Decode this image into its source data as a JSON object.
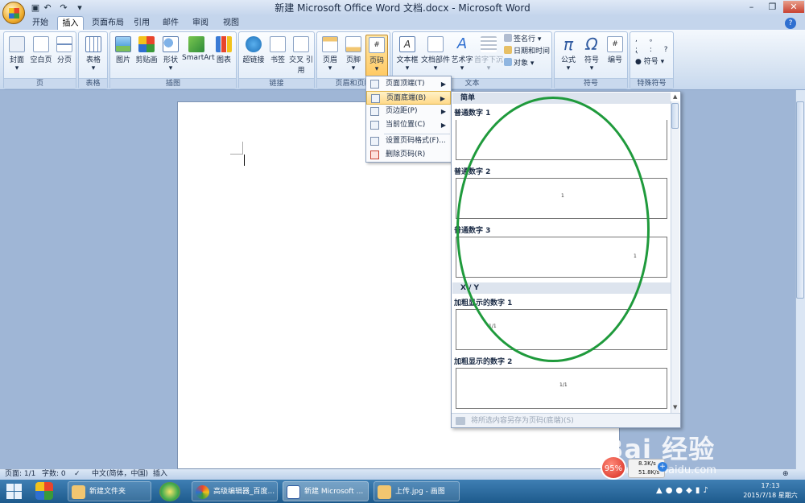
{
  "window": {
    "title": "新建 Microsoft Office Word 文档.docx - Microsoft Word"
  },
  "quick_access": {
    "save": "💾",
    "undo": "↶",
    "redo": "↷",
    "customize": "▾"
  },
  "tabs": [
    "开始",
    "插入",
    "页面布局",
    "引用",
    "邮件",
    "审阅",
    "视图"
  ],
  "active_tab": "插入",
  "ribbon": {
    "groups": [
      {
        "label": "页",
        "buttons": [
          "封面",
          "空白页",
          "分页"
        ]
      },
      {
        "label": "表格",
        "buttons": [
          "表格"
        ]
      },
      {
        "label": "插图",
        "buttons": [
          "图片",
          "剪贴画",
          "形状",
          "SmartArt",
          "图表"
        ]
      },
      {
        "label": "链接",
        "buttons": [
          "超链接",
          "书签",
          "交叉\n引用"
        ]
      },
      {
        "label": "页眉和页脚",
        "buttons": [
          "页眉",
          "页脚",
          "页码"
        ]
      },
      {
        "label": "文本",
        "buttons": [
          "文本框",
          "文档部件",
          "艺术字",
          "首字下沉"
        ],
        "small": [
          "签名行",
          "日期和时间",
          "对象"
        ]
      },
      {
        "label": "符号",
        "buttons": [
          "公式",
          "符号",
          "编号"
        ]
      },
      {
        "label": "特殊符号",
        "buttons": [
          "符号"
        ]
      }
    ]
  },
  "menu": {
    "items": [
      {
        "label": "页面顶端(T)",
        "submenu": true
      },
      {
        "label": "页面底端(B)",
        "submenu": true,
        "highlighted": true
      },
      {
        "label": "页边距(P)",
        "submenu": true
      },
      {
        "label": "当前位置(C)",
        "submenu": true
      },
      {
        "label": "设置页码格式(F)...",
        "submenu": false
      },
      {
        "label": "删除页码(R)",
        "submenu": false
      }
    ]
  },
  "gallery": {
    "sections": [
      {
        "header": "简单",
        "items": [
          {
            "title": "普通数字 1",
            "preview": ""
          },
          {
            "title": "普通数字 2",
            "preview": "1"
          },
          {
            "title": "普通数字 3",
            "preview": "1"
          }
        ]
      },
      {
        "header": "X / Y",
        "items": [
          {
            "title": "加粗显示的数字 1",
            "preview": "1/1"
          },
          {
            "title": "加粗显示的数字 2",
            "preview": "1/1"
          }
        ]
      }
    ],
    "footer": "将所选内容另存为页码(底端)(S)"
  },
  "status": {
    "page": "页面: 1/1",
    "words": "字数: 0",
    "language": "中文(简体，中国)",
    "mode": "插入"
  },
  "taskbar": {
    "items": [
      "新建文件夹",
      "高级编辑器_百度...",
      "新建 Microsoft ...",
      "上传.jpg - 画图"
    ],
    "time": "17:13",
    "date": "2015/7/18 星期六"
  },
  "overlay": {
    "speed_percent": "95%",
    "upload": "8.3K/s",
    "download": "51.8K/s",
    "plus": "+"
  },
  "watermark": {
    "brand": "Bai  经验",
    "url": "jingyan.baidu.com"
  },
  "colors": {
    "annotation": "#1f9a3c",
    "highlight": "#ffd98a"
  }
}
